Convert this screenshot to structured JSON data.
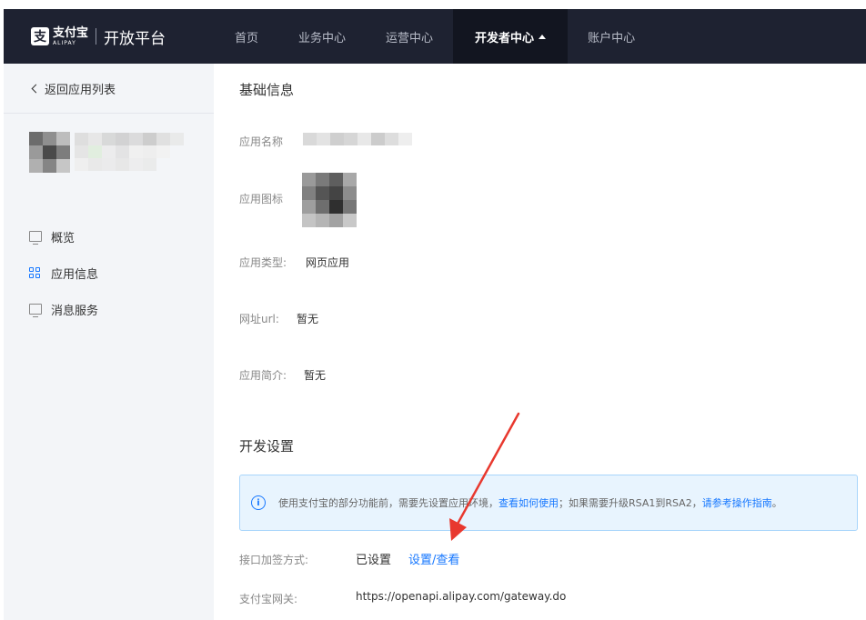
{
  "header": {
    "logo_mark": "支",
    "brand_cn": "支付宝",
    "brand_en": "ALIPAY",
    "platform": "开放平台",
    "nav": [
      {
        "label": "首页"
      },
      {
        "label": "业务中心"
      },
      {
        "label": "运营中心"
      },
      {
        "label": "开发者中心",
        "active": true
      },
      {
        "label": "账户中心"
      }
    ]
  },
  "sidebar": {
    "back_label": "返回应用列表",
    "menu": [
      {
        "label": "概览",
        "icon": "monitor-icon"
      },
      {
        "label": "应用信息",
        "icon": "grid-icon",
        "active": true
      },
      {
        "label": "消息服务",
        "icon": "message-icon"
      }
    ]
  },
  "basic_info": {
    "title": "基础信息",
    "app_name_label": "应用名称",
    "app_icon_label": "应用图标",
    "app_type_label": "应用类型:",
    "app_type_value": "网页应用",
    "url_label": "网址url:",
    "url_value": "暂无",
    "intro_label": "应用简介:",
    "intro_value": "暂无"
  },
  "dev_settings": {
    "title": "开发设置",
    "alert": {
      "text_1": "使用支付宝的部分功能前，需要先设置应用环境，",
      "link_1": "查看如何使用",
      "text_2": "；如果需要升级RSA1到RSA2，",
      "link_2": "请参考操作指南",
      "text_3": "。"
    },
    "sign_label": "接口加签方式:",
    "sign_status": "已设置",
    "sign_link": "设置/查看",
    "gateway_label": "支付宝网关:",
    "gateway_value": "https://openapi.alipay.com/gateway.do"
  },
  "colors": {
    "header_bg": "#1e2231",
    "accent": "#1677ff",
    "annotation_arrow": "#e8382e"
  }
}
